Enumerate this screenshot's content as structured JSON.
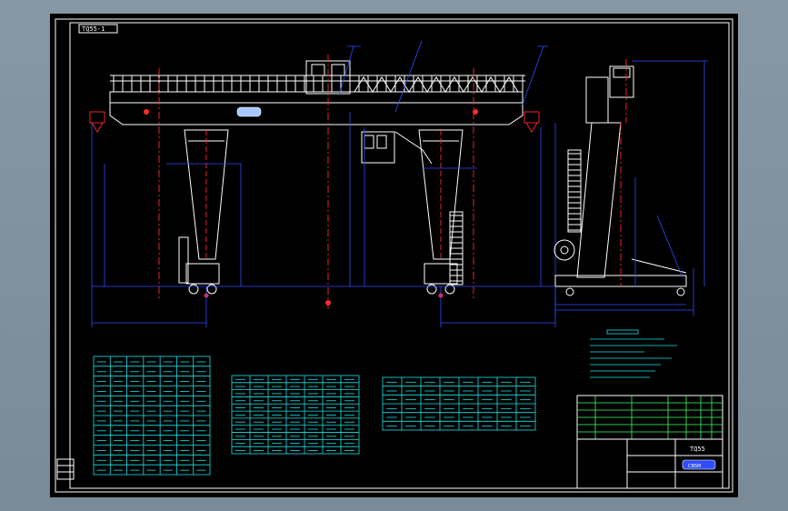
{
  "drawing": {
    "label_tl": "TQ55-1",
    "label_tr": "TQ55",
    "logo_text": "CBSM",
    "tables": {
      "left_rows": 12,
      "left_cols": 7,
      "mid_rows": 11,
      "mid_cols": 7,
      "right_rows": 6,
      "right_cols": 8
    },
    "colors": {
      "sheet": "#000000",
      "frame": "#ffffff",
      "dimension": "#2f4dff",
      "center_line": "#ff2a2a",
      "text": "#19e3e6",
      "table": "#3cff66"
    }
  }
}
